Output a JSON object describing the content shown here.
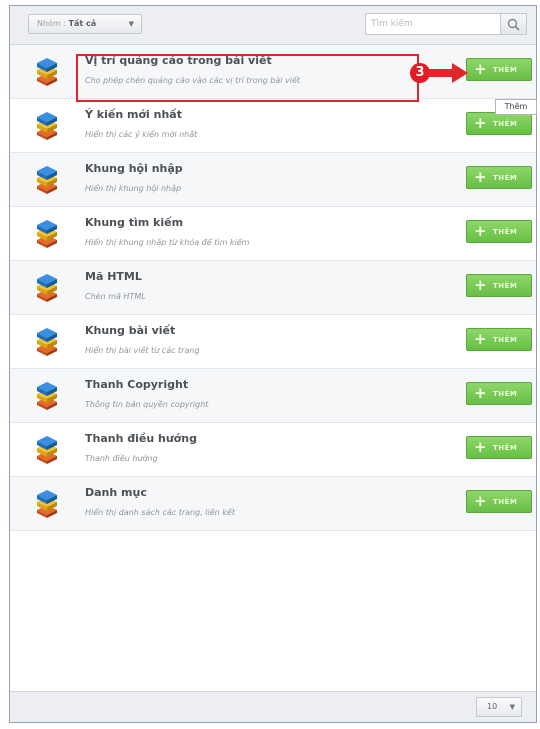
{
  "toolbar": {
    "group_label": "Nhóm :",
    "group_value": "Tất cả",
    "search_placeholder": "Tìm kiếm"
  },
  "widgets": [
    {
      "title": "Vị trí quảng cáo trong bài viết",
      "desc": "Cho phép chèn quảng cáo vào các vị trí trong bài viết",
      "button": "THÊM"
    },
    {
      "title": "Ý kiến mới nhất",
      "desc": "Hiển thị các ý kiến mới nhất",
      "button": "THÊM"
    },
    {
      "title": "Khung hội nhập",
      "desc": "Hiển thị khung hội nhập",
      "button": "THÊM"
    },
    {
      "title": "Khung tìm kiếm",
      "desc": "Hiển thị khung nhập từ khóa để tìm kiếm",
      "button": "THÊM"
    },
    {
      "title": "Mã HTML",
      "desc": "Chèn mã HTML",
      "button": "THÊM"
    },
    {
      "title": "Khung bài viết",
      "desc": "Hiển thị bài viết từ các trang",
      "button": "THÊM"
    },
    {
      "title": "Thanh Copyright",
      "desc": "Thông tin bản quyền copyright",
      "button": "THÊM"
    },
    {
      "title": "Thanh điều hướng",
      "desc": "Thanh điều hướng",
      "button": "THÊM"
    },
    {
      "title": "Danh mục",
      "desc": "Hiển thị danh sách các trang, liên kết",
      "button": "THÊM"
    }
  ],
  "annotation": {
    "step_number": "3",
    "tooltip": "Thêm"
  },
  "footer": {
    "page_size": "10"
  },
  "colors": {
    "accent_green": "#68bf44",
    "highlight_red": "#e0262b"
  },
  "icons": {
    "widget": "stacked-blocks-icon",
    "search": "search-icon",
    "dropdown": "chevron-down-icon",
    "add": "plus-icon"
  }
}
